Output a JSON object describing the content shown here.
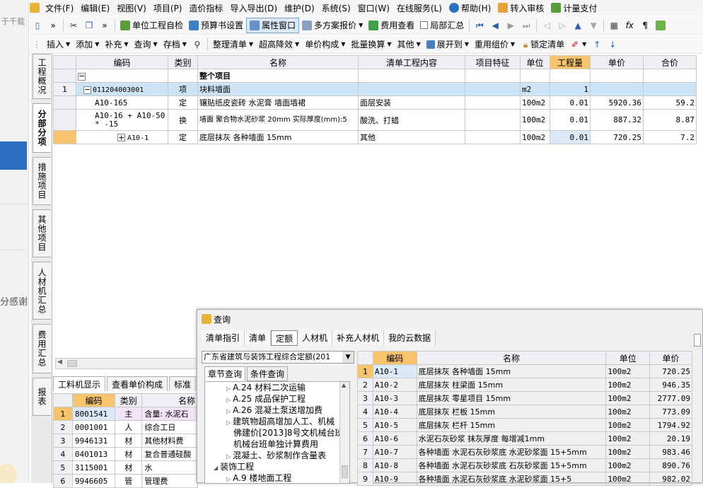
{
  "left_strip": {
    "snippet_top": "于千载",
    "snippet_mid": "分感谢"
  },
  "menu": [
    "文件(F)",
    "编辑(E)",
    "视图(V)",
    "项目(P)",
    "造价指标",
    "导入导出(D)",
    "维护(D)",
    "系统(S)",
    "窗口(W)",
    "在线服务(L)",
    "帮助(H)",
    "转入审核",
    "计量支付"
  ],
  "toolbar1": {
    "btn1": "单位工程自检",
    "btn2": "预算书设置",
    "btn3": "属性窗口",
    "btn4": "多方案报价",
    "btn5": "费用查看",
    "btn6": "局部汇总"
  },
  "toolbar2": [
    "插入",
    "添加",
    "补充",
    "查询",
    "存档",
    "整理清单",
    "超高降效",
    "单价构成",
    "批量换算",
    "其他",
    "展开到",
    "重用组价",
    "锁定清单"
  ],
  "vtabs": [
    "工程概况",
    "分部分项",
    "措施项目",
    "其他项目",
    "人材机汇总",
    "费用汇总",
    "报表"
  ],
  "main_headers": [
    "编码",
    "类别",
    "名称",
    "清单工程内容",
    "项目特征",
    "单位",
    "工程量",
    "单价",
    "合价"
  ],
  "main_rows": [
    {
      "no": "",
      "code": "",
      "type": "",
      "name": "整个项目",
      "content": "",
      "feature": "",
      "unit": "",
      "qty": "",
      "price": "",
      "total": ""
    },
    {
      "no": "1",
      "code": "011204003001",
      "type": "项",
      "name": "块料墙面",
      "content": "",
      "feature": "",
      "unit": "m2",
      "qty": "1",
      "price": "",
      "total": ""
    },
    {
      "no": "",
      "code": "A10-165",
      "type": "定",
      "name": "镶贴纸皮瓷砖 水泥膏 墙面墙裙",
      "content": "面层安装",
      "feature": "",
      "unit": "100m2",
      "qty": "0.01",
      "price": "5920.36",
      "total": "59.2"
    },
    {
      "no": "",
      "code": "A10-16 + A10-50 * -15",
      "type": "换",
      "name": "墙面 聚合物水泥砂浆 20mm 实际厚度(mm):5",
      "content": "酸洗、打蜡",
      "feature": "",
      "unit": "100m2",
      "qty": "0.01",
      "price": "887.32",
      "total": "8.87"
    },
    {
      "no": "",
      "code": "A10-1",
      "type": "定",
      "name": "底层抹灰 各种墙面 15mm",
      "content": "其他",
      "feature": "",
      "unit": "100m2",
      "qty": "0.01",
      "price": "720.25",
      "total": "7.2"
    }
  ],
  "bottom_tabs": [
    "工料机显示",
    "查看单价构成",
    "标准"
  ],
  "bottom_headers": [
    "编码",
    "类别",
    "名称"
  ],
  "bottom_rows": [
    {
      "no": "1",
      "code": "8001541",
      "type": "主",
      "name": "含量: 水泥石"
    },
    {
      "no": "2",
      "code": "0001001",
      "type": "人",
      "name": "综合工日"
    },
    {
      "no": "3",
      "code": "9946131",
      "type": "材",
      "name": "其他材料费"
    },
    {
      "no": "4",
      "code": "0401013",
      "type": "材",
      "name": "复合普通硅酸"
    },
    {
      "no": "5",
      "code": "3115001",
      "type": "材",
      "name": "水"
    },
    {
      "no": "6",
      "code": "9946605",
      "type": "管",
      "name": "管理费"
    }
  ],
  "query": {
    "title": "查询",
    "tabs": [
      "清单指引",
      "清单",
      "定额",
      "人材机",
      "补充人材机",
      "我的云数据"
    ],
    "combo": "广东省建筑与装饰工程综合定额(201",
    "subtabs": [
      "章节查询",
      "条件查询"
    ],
    "tree": [
      {
        "t": "A.24 材料二次运输",
        "arrow": "▷",
        "ind": 30
      },
      {
        "t": "A.25 成品保护工程",
        "arrow": "▷",
        "ind": 30
      },
      {
        "t": "A.26 混凝土泵送增加费",
        "arrow": "▷",
        "ind": 30
      },
      {
        "t": "建筑物超高增加人工、机械",
        "arrow": "▷",
        "ind": 30
      },
      {
        "t": "佛建价[2013]8号文机械台班",
        "arrow": "",
        "ind": 40
      },
      {
        "t": "机械台班单独计算费用",
        "arrow": "",
        "ind": 40
      },
      {
        "t": "混凝土、砂浆制作含量表",
        "arrow": "▷",
        "ind": 30
      },
      {
        "t": "装饰工程",
        "arrow": "◢",
        "ind": 12
      },
      {
        "t": "A.9 楼地面工程",
        "arrow": "▷",
        "ind": 30
      }
    ],
    "grid_headers": [
      "编码",
      "名称",
      "单位",
      "单价"
    ],
    "grid_rows": [
      {
        "no": "1",
        "code": "A10-1",
        "name": "底层抹灰 各种墙面 15mm",
        "unit": "100m2",
        "price": "720.25"
      },
      {
        "no": "2",
        "code": "A10-2",
        "name": "底层抹灰 柱梁面 15mm",
        "unit": "100m2",
        "price": "946.35"
      },
      {
        "no": "3",
        "code": "A10-3",
        "name": "底层抹灰 零星项目 15mm",
        "unit": "100m2",
        "price": "2777.09"
      },
      {
        "no": "4",
        "code": "A10-4",
        "name": "底层抹灰 栏板 15mm",
        "unit": "100m2",
        "price": "773.09"
      },
      {
        "no": "5",
        "code": "A10-5",
        "name": "底层抹灰 栏杆 15mm",
        "unit": "100m2",
        "price": "1794.92"
      },
      {
        "no": "6",
        "code": "A10-6",
        "name": "水泥石灰砂浆 抹灰厚度 每增减1mm",
        "unit": "100m2",
        "price": "20.19"
      },
      {
        "no": "7",
        "code": "A10-7",
        "name": "各种墙面 水泥石灰砂浆底 水泥砂浆面 15+5mm",
        "unit": "100m2",
        "price": "983.46"
      },
      {
        "no": "8",
        "code": "A10-8",
        "name": "各种墙面 水泥石灰砂浆底 石灰砂浆面 15+5mm",
        "unit": "100m2",
        "price": "890.76"
      },
      {
        "no": "9",
        "code": "A10-9",
        "name": "各种墙面 水泥石灰砂浆底 水泥砂浆面 15+5",
        "unit": "100m2",
        "price": "982.02"
      }
    ]
  }
}
